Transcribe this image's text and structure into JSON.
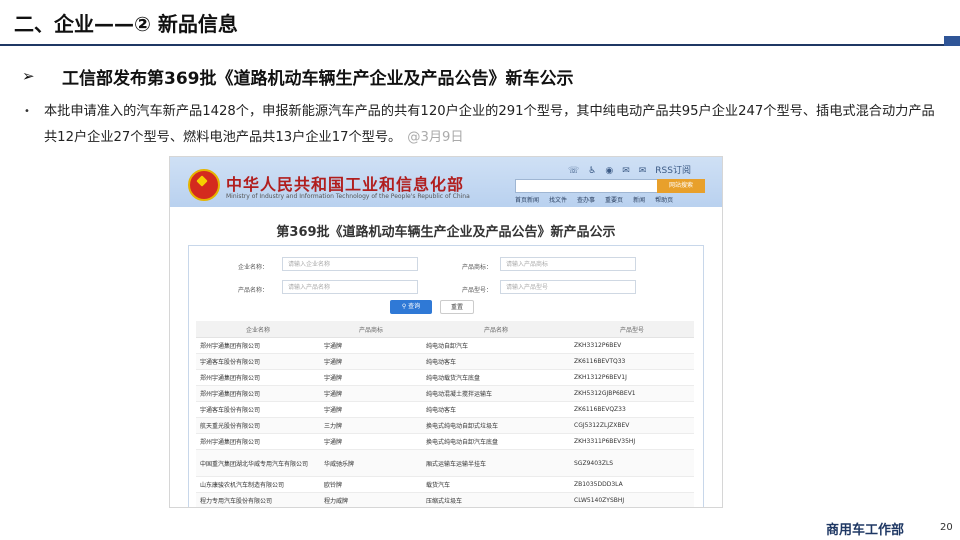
{
  "slide": {
    "title": "二、企业——② 新品信息",
    "subheading": "工信部发布第369批《道路机动车辆生产企业及产品公告》新车公示",
    "paragraph": "本批申请准入的汽车新产品1428个，申报新能源汽车产品的共有120户企业的291个型号，其中纯电动产品共95户企业247个型号、插电式混合动力产品共12户企业27个型号、燃料电池产品共13户企业17个型号。",
    "paragraph_date": "@3月9日",
    "footer_dept": "商用车工作部",
    "page_number": "20"
  },
  "screenshot": {
    "ministry_name": "中华人民共和国工业和信息化部",
    "ministry_name_en": "Ministry of Industry and Information Technology of the People's Republic of China",
    "top_links": [
      "RSS订阅"
    ],
    "search_button": "网站搜索",
    "nav_items": [
      "首页新闻",
      "找文件",
      "查办事",
      "重要页",
      "新闻",
      "帮助页"
    ],
    "notice_title": "第369批《道路机动车辆生产企业及产品公告》新产品公示",
    "form": {
      "company_label": "企业名称：",
      "company_placeholder": "请输入企业名称",
      "brand_label": "产品商标：",
      "brand_placeholder": "请输入产品商标",
      "product_label": "产品名称：",
      "product_placeholder": "请输入产品名称",
      "model_label": "产品型号：",
      "model_placeholder": "请输入产品型号",
      "query_button": "查询",
      "reset_button": "重置"
    },
    "table": {
      "headers": [
        "企业名称",
        "产品商标",
        "产品名称",
        "产品型号"
      ],
      "rows": [
        [
          "郑州宇通集团有限公司",
          "宇通牌",
          "纯电动自卸汽车",
          "ZKH3312P6BEV"
        ],
        [
          "宇通客车股份有限公司",
          "宇通牌",
          "纯电动客车",
          "ZK6116BEVTQ33"
        ],
        [
          "郑州宇通集团有限公司",
          "宇通牌",
          "纯电动载货汽车底盘",
          "ZKH1312P6BEV1J"
        ],
        [
          "郑州宇通集团有限公司",
          "宇通牌",
          "纯电动混凝土搅拌运输车",
          "ZKH5312GJBP6BEV1"
        ],
        [
          "宇通客车股份有限公司",
          "宇通牌",
          "纯电动客车",
          "ZK6116BEVQZ33"
        ],
        [
          "航天重光股份有限公司",
          "三力牌",
          "换电式纯电动自卸式垃圾车",
          "CGJ5312ZLJZXBEV"
        ],
        [
          "郑州宇通集团有限公司",
          "宇通牌",
          "换电式纯电动自卸汽车底盘",
          "ZKH3311P6BEV35HJ"
        ],
        [
          "中国重汽集团湖北华威专用汽车有限公司",
          "华威驰乐牌",
          "厢式运输车运输半挂车",
          "SGZ9403ZLS"
        ],
        [
          "山东康骏农机汽车制造有限公司",
          "欧铃牌",
          "载货汽车",
          "ZB1035DDD3LA"
        ],
        [
          "程力专用汽车股份有限公司",
          "程力威牌",
          "压缩式垃圾车",
          "CLW5140ZYSBHJ"
        ]
      ]
    }
  }
}
